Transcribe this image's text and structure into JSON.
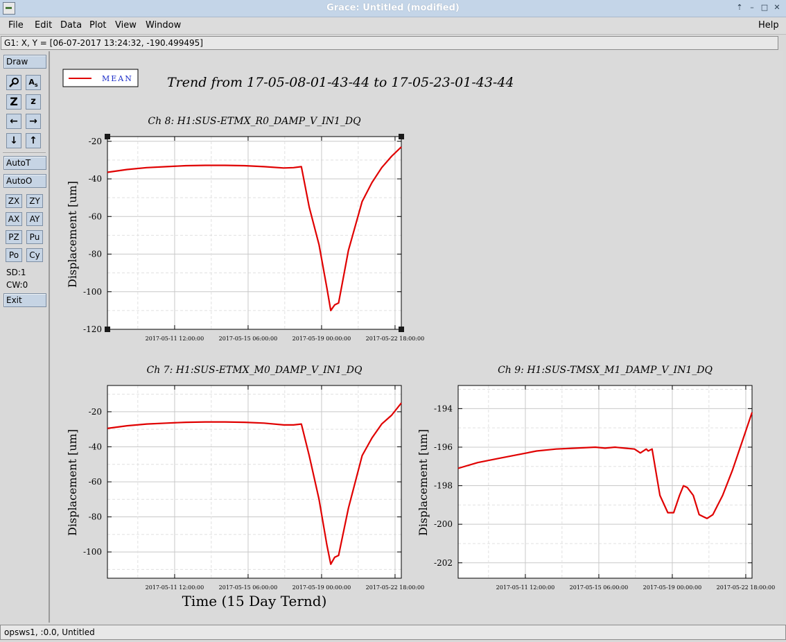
{
  "window": {
    "title": "Grace: Untitled (modified)",
    "icon": "grace-app-icon"
  },
  "menubar": {
    "file": "File",
    "edit": "Edit",
    "data": "Data",
    "plot": "Plot",
    "view": "View",
    "window": "Window",
    "help": "Help"
  },
  "locator": {
    "text": "G1: X, Y = [06-07-2017 13:24:32, -190.499495]"
  },
  "toolbar": {
    "draw": "Draw",
    "autot": "AutoT",
    "autoo": "AutoO",
    "zx": "ZX",
    "zy": "ZY",
    "ax": "AX",
    "ay": "AY",
    "pz": "PZ",
    "pu": "Pu",
    "po": "Po",
    "cy": "Cy",
    "sd": "SD:1",
    "cw": "CW:0",
    "exit": "Exit"
  },
  "status": {
    "text": "opsws1, :0.0, Untitled"
  },
  "plot": {
    "legend_label": "MEAN",
    "main_title": "Trend from 17-05-08-01-43-44 to 17-05-23-01-43-44",
    "xlabel": "Time (15 Day Ternd)",
    "colors": {
      "line": "#e00000",
      "legend_text": "#1a2cc8"
    }
  },
  "chart_data": [
    {
      "type": "line",
      "title": "Ch 8: H1:SUS-ETMX_R0_DAMP_V_IN1_DQ",
      "ylabel": "Displacement [um]",
      "xlim": [
        0,
        15
      ],
      "ylim": [
        -120,
        -17.5
      ],
      "yticks": [
        -120,
        -100,
        -80,
        -60,
        -40,
        -20
      ],
      "xticks": [
        3.43,
        7.18,
        10.93,
        14.68
      ],
      "xtick_labels": [
        "2017-05-11 12:00:00",
        "2017-05-15 06:00:00",
        "2017-05-19 00:00:00",
        "2017-05-22 18:00:00"
      ],
      "grid": true,
      "series": [
        {
          "name": "MEAN",
          "x": [
            0,
            1,
            2,
            3,
            4,
            5,
            6,
            7,
            8,
            9,
            9.5,
            9.9,
            10.3,
            10.8,
            11.2,
            11.4,
            11.6,
            11.8,
            12.3,
            13,
            13.5,
            14,
            14.5,
            15
          ],
          "y": [
            -36.5,
            -35,
            -34,
            -33.5,
            -33,
            -32.8,
            -32.8,
            -33,
            -33.5,
            -34.2,
            -34,
            -33.5,
            -55,
            -75,
            -98,
            -110,
            -107,
            -106,
            -78,
            -52,
            -42,
            -34,
            -28,
            -23
          ]
        }
      ]
    },
    {
      "type": "line",
      "title": "Ch 7: H1:SUS-ETMX_M0_DAMP_V_IN1_DQ",
      "ylabel": "Displacement [um]",
      "xlim": [
        0,
        15
      ],
      "ylim": [
        -115,
        -5
      ],
      "yticks": [
        -100,
        -80,
        -60,
        -40,
        -20
      ],
      "xticks": [
        3.43,
        7.18,
        10.93,
        14.68
      ],
      "xtick_labels": [
        "2017-05-11 12:00:00",
        "2017-05-15 06:00:00",
        "2017-05-19 00:00:00",
        "2017-05-22 18:00:00"
      ],
      "grid": true,
      "series": [
        {
          "name": "MEAN",
          "x": [
            0,
            1,
            2,
            3,
            4,
            5,
            6,
            7,
            8,
            9,
            9.5,
            9.9,
            10.3,
            10.8,
            11.2,
            11.4,
            11.6,
            11.8,
            12.3,
            13,
            13.5,
            14,
            14.5,
            15
          ],
          "y": [
            -29.5,
            -28,
            -27,
            -26.5,
            -26,
            -25.8,
            -25.8,
            -26,
            -26.5,
            -27.5,
            -27.5,
            -27,
            -45,
            -70,
            -96,
            -107,
            -103,
            -102,
            -75,
            -45,
            -35,
            -27,
            -22,
            -15
          ]
        }
      ]
    },
    {
      "type": "line",
      "title": "Ch 9: H1:SUS-TMSX_M1_DAMP_V_IN1_DQ",
      "ylabel": "Displacement [um]",
      "xlim": [
        0,
        15
      ],
      "ylim": [
        -202.8,
        -192.8
      ],
      "yticks": [
        -202,
        -200,
        -198,
        -196,
        -194
      ],
      "xticks": [
        3.43,
        7.18,
        10.93,
        14.68
      ],
      "xtick_labels": [
        "2017-05-11 12:00:00",
        "2017-05-15 06:00:00",
        "2017-05-19 00:00:00",
        "2017-05-22 18:00:00"
      ],
      "grid": true,
      "series": [
        {
          "name": "MEAN",
          "x": [
            0,
            1,
            2,
            3,
            4,
            5,
            6,
            7,
            7.5,
            8,
            8.5,
            9,
            9.3,
            9.6,
            9.7,
            9.9,
            10.3,
            10.7,
            11,
            11.3,
            11.5,
            11.7,
            12,
            12.3,
            12.7,
            13,
            13.5,
            14,
            14.5,
            15
          ],
          "y": [
            -197.1,
            -196.8,
            -196.6,
            -196.4,
            -196.2,
            -196.1,
            -196.05,
            -196,
            -196.05,
            -196,
            -196.05,
            -196.1,
            -196.3,
            -196.1,
            -196.2,
            -196.1,
            -198.5,
            -199.4,
            -199.4,
            -198.5,
            -198,
            -198.1,
            -198.5,
            -199.5,
            -199.7,
            -199.5,
            -198.5,
            -197.2,
            -195.7,
            -194.2
          ]
        }
      ]
    }
  ]
}
